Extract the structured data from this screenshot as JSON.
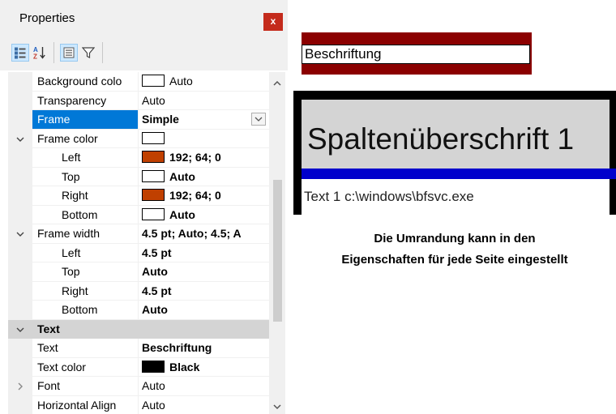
{
  "panel": {
    "title": "Properties",
    "close_glyph": "x",
    "toolbar": {
      "buttons": [
        {
          "icon": "categorized-view-icon",
          "active": true
        },
        {
          "icon": "alphabetical-sort-icon",
          "active": false
        },
        {
          "icon": "property-pages-icon",
          "active": true
        },
        {
          "icon": "filter-icon",
          "active": false
        }
      ]
    }
  },
  "grid": {
    "rows": [
      {
        "name": "Background colo",
        "value": "Auto",
        "swatch": "#ffffff",
        "bold": false
      },
      {
        "name": "Transparency",
        "value": "Auto",
        "bold": false
      },
      {
        "name": "Frame",
        "value": "Simple",
        "bold": true,
        "selected": true,
        "has_dropdown": true
      },
      {
        "name": "Frame color",
        "value": "",
        "swatch": "#ffffff",
        "expanded": true
      },
      {
        "name": "Left",
        "value": "192; 64; 0",
        "swatch": "#c04000",
        "bold": true,
        "sub": true
      },
      {
        "name": "Top",
        "value": "Auto",
        "swatch": "#ffffff",
        "bold": true,
        "sub": true
      },
      {
        "name": "Right",
        "value": "192; 64; 0",
        "swatch": "#c04000",
        "bold": true,
        "sub": true
      },
      {
        "name": "Bottom",
        "value": "Auto",
        "swatch": "#ffffff",
        "bold": true,
        "sub": true
      },
      {
        "name": "Frame width",
        "value": "4.5 pt; Auto; 4.5; A",
        "bold": true,
        "expanded": true
      },
      {
        "name": "Left",
        "value": "4.5 pt",
        "bold": true,
        "sub": true
      },
      {
        "name": "Top",
        "value": "Auto",
        "bold": true,
        "sub": true
      },
      {
        "name": "Right",
        "value": "4.5 pt",
        "bold": true,
        "sub": true
      },
      {
        "name": "Bottom",
        "value": "Auto",
        "bold": true,
        "sub": true
      },
      {
        "name": "Text",
        "value": "",
        "category": true,
        "expanded": true
      },
      {
        "name": "Text",
        "value": "Beschriftung",
        "bold": true
      },
      {
        "name": "Text color",
        "value": "Black",
        "swatch": "#000000",
        "bold": true
      },
      {
        "name": "Font",
        "value": "Auto",
        "bold": false,
        "collapsed": true
      },
      {
        "name": "Horizontal Align",
        "value": "Auto",
        "bold": false
      }
    ]
  },
  "preview": {
    "caption_text": "Beschriftung",
    "caption_band_color": "#8b0000",
    "table_header": "Spaltenüberschrift 1",
    "table_cell": "Text 1 c:\\windows\\bfsvc.exe",
    "separator_color": "#0000cc",
    "description_line1": "Die Umrandung kann in den",
    "description_line2": "Eigenschaften für jede Seite eingestellt"
  },
  "colors": {
    "selection": "#0078d7",
    "close_button": "#c42b1c",
    "frame_color_left_right": "#c04000"
  }
}
